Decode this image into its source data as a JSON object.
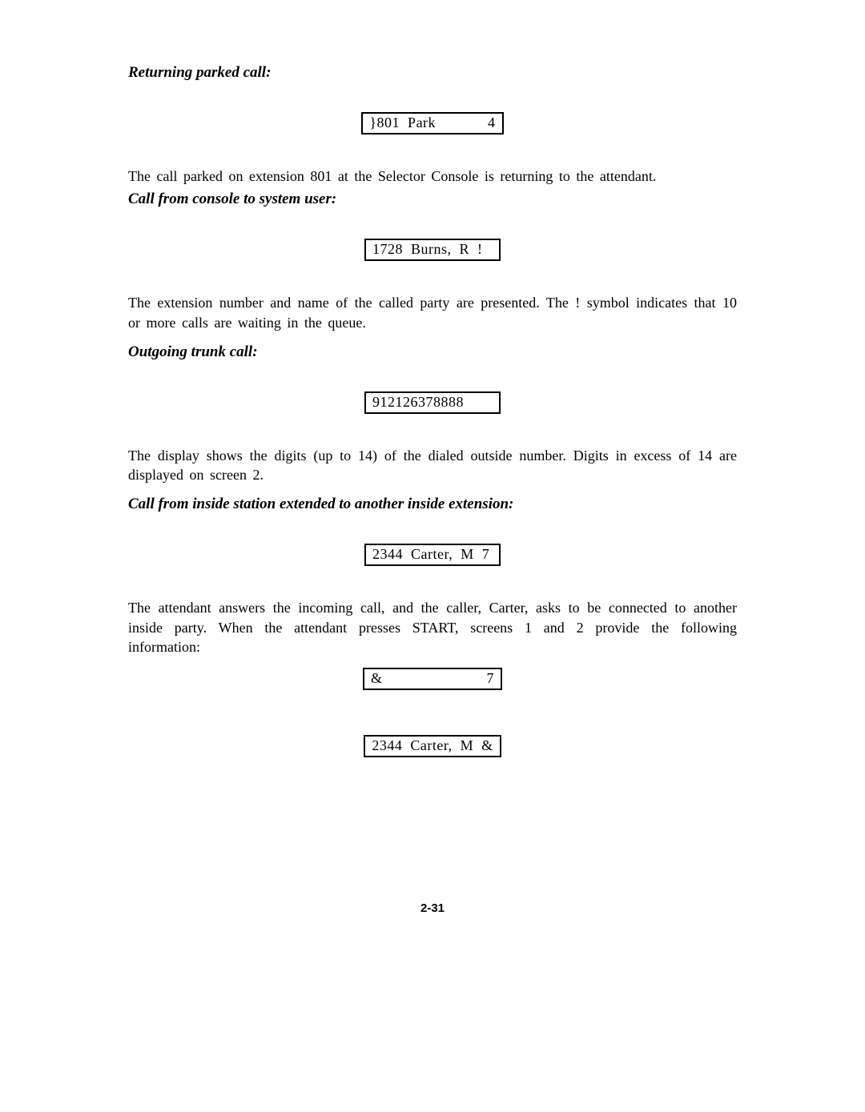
{
  "sections": {
    "returning": {
      "heading": "Returning parked call:",
      "display": "}801  Park             4",
      "para": "The  call  parked  on  extension  801  at  the  Selector  Console  is  returning  to  the  attendant."
    },
    "console_to_user": {
      "heading": "Call from console to system user:",
      "display": "1728  Burns,  R  !",
      "para": "The  extension  number  and  name  of  the  called  party  are  presented.  The  !  symbol  indicates that  10  or  more  calls  are  waiting  in  the  queue."
    },
    "outgoing": {
      "heading": "Outgoing trunk call:",
      "display": "912126378888",
      "para": "The  display  shows  the  digits  (up  to  14)  of  the  dialed  outside  number.  Digits  in  excess  of  14 are  displayed  on  screen  2."
    },
    "extended": {
      "heading": "Call from inside station extended to another inside extension:",
      "display1": "2344  Carter,  M  7",
      "para": "The  attendant  answers  the  incoming  call,  and  the  caller,  Carter,  asks  to  be  connected  to another  inside  party.   When  the  attendant  presses  START,  screens  1  and  2  provide  the following   information:",
      "display2": "&                          7",
      "display3": "2344  Carter,  M  &"
    }
  },
  "page_number": "2-31"
}
